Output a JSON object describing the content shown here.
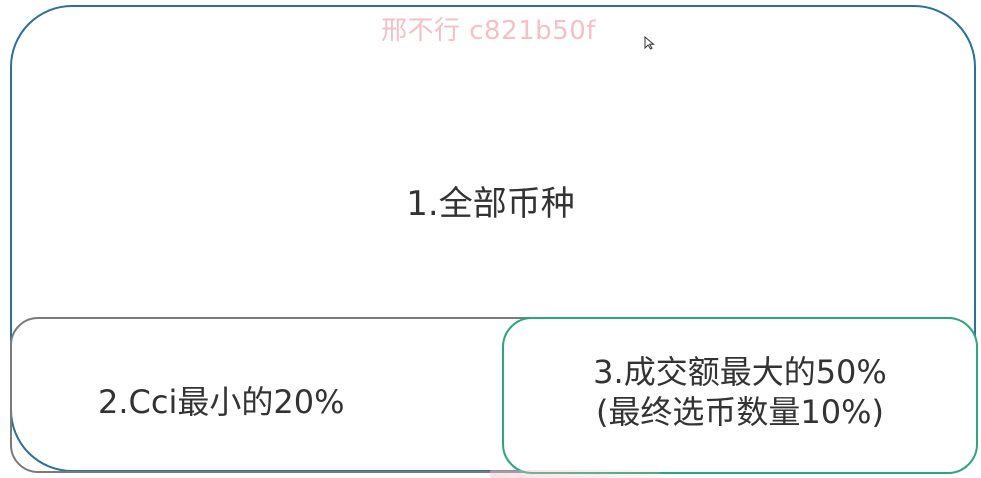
{
  "watermark": {
    "text": "邢不行 c821b50f"
  },
  "diagram": {
    "box_all": {
      "label": "1.全部币种"
    },
    "box_cci": {
      "label": "2.Cci最小的20%"
    },
    "box_volume": {
      "line1": "3.成交额最大的50%",
      "line2": "(最终选币数量10%)"
    }
  },
  "colors": {
    "outer_border": "#2e6f9e",
    "left_border": "#7b7b7b",
    "right_border": "#2aa879",
    "watermark": "#f3c0c8",
    "text": "#333333"
  },
  "icons": {
    "cursor": "mouse-pointer-icon"
  }
}
